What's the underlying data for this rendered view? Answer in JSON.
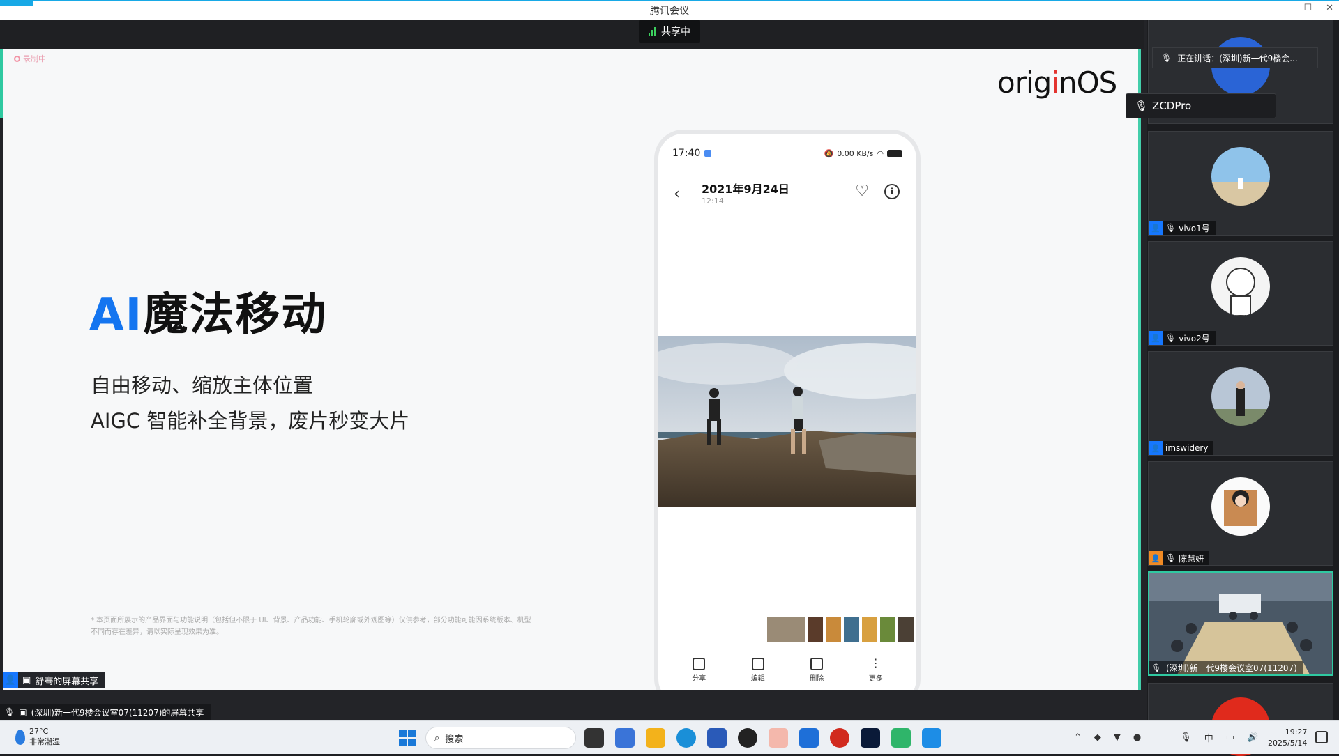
{
  "window": {
    "title": "腾讯会议"
  },
  "share_status": {
    "label": "共享中"
  },
  "slide": {
    "rec_label": "录制中",
    "logo": {
      "prefix": "orig",
      "dot_letter": "i",
      "suffix": "nOS"
    },
    "headline_ai": "AI",
    "headline_rest": "魔法移动",
    "sub1": "自由移动、缩放主体位置",
    "sub2": "AIGC 智能补全背景，废片秒变大片",
    "disclaimer": "* 本页面所展示的产品界面与功能说明（包括但不限于 UI、背景、产品功能、手机轮廓或外观图等）仅供参考，部分功能可能因系统版本、机型不同而存在差异，请以实际呈现效果为准。"
  },
  "phone": {
    "status_time": "17:40",
    "status_right": "0.00 KB/s",
    "date": "2021年9月24日",
    "time": "12:14",
    "back_icon": "chevron-left-icon",
    "actions": [
      {
        "label": "分享",
        "icon": "share-icon"
      },
      {
        "label": "编辑",
        "icon": "edit-icon"
      },
      {
        "label": "删除",
        "icon": "trash-icon"
      },
      {
        "label": "更多",
        "icon": "more-icon"
      }
    ]
  },
  "presenter": {
    "label": "舒骞的屏幕共享"
  },
  "share_label": {
    "text": "(深圳)新一代9楼会议室07(11207)的屏幕共享"
  },
  "sidebar": {
    "tooltip": "正在讲话：(深圳)新一代9楼会...",
    "speaker_card": "ZCDPro",
    "tiles": [
      {
        "name": "vivo1号"
      },
      {
        "name": "vivo2号"
      },
      {
        "name": "imswidery"
      },
      {
        "name": "陈慧妍"
      },
      {
        "name": "(深圳)新一代9楼会议室07(11207)"
      }
    ]
  },
  "taskbar": {
    "weather_temp": "27°C",
    "weather_desc": "非常潮湿",
    "search_placeholder": "搜索",
    "ime": "中",
    "clock_time": "19:27",
    "clock_date": "2025/5/14"
  },
  "colors": {
    "accent": "#1475f0",
    "frame": "#2fc9a1",
    "title_accent": "#18a9e6",
    "share_green": "#3ccf5e"
  }
}
